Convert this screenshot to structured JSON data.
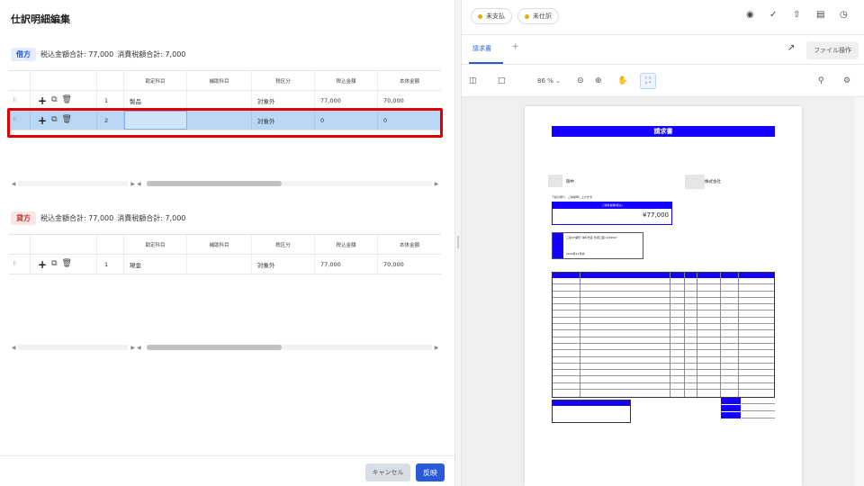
{
  "left": {
    "title": "仕訳明細編集",
    "debit": {
      "badge": "借方",
      "tax_incl_total": "税込金額合計: 77,000",
      "tax_total": "消費税額合計: 7,000"
    },
    "credit": {
      "badge": "貸方",
      "tax_incl_total": "税込金額合計: 77,000",
      "tax_total": "消費税額合計: 7,000"
    },
    "columns": {
      "account": "勘定科目",
      "subaccount": "補助科目",
      "tax_type": "税区分",
      "amount": "税込金額",
      "net": "本体金額"
    },
    "debit_rows": [
      {
        "no": "1",
        "account": "製品",
        "subaccount": "",
        "tax_type": "対象外",
        "amount": "77,000",
        "net": "70,000"
      },
      {
        "no": "2",
        "account": "",
        "subaccount": "",
        "tax_type": "対象外",
        "amount": "0",
        "net": "0"
      }
    ],
    "credit_rows": [
      {
        "no": "1",
        "account": "現金",
        "subaccount": "",
        "tax_type": "対象外",
        "amount": "77,000",
        "net": "70,000"
      }
    ],
    "actions": {
      "add": "+",
      "copy": "⧉",
      "delete": "🗑",
      "handle": "⠿"
    },
    "scroll": {
      "left": "◀",
      "right": "▶",
      "mid": "▶ ◀"
    },
    "footer": {
      "cancel": "キャンセル",
      "apply": "反映"
    }
  },
  "right": {
    "status_chips": [
      "未支払",
      "未仕訳"
    ],
    "status_color": "#f0a800",
    "top_icons": [
      "user-circle-icon",
      "check-icon",
      "share-icon",
      "comment-icon",
      "clock-icon"
    ],
    "tab": "請求書",
    "tab_add": "+",
    "file_ops": "ファイル操作",
    "zoom": "86 %",
    "invoice": {
      "banner": "請求書",
      "to_suffix": "御中",
      "from_name": "株式会社",
      "greeting": "下記の通り、ご請求申し上げます。",
      "amount_label": "ご請求金額(税込)",
      "amount": "¥77,000",
      "bank_line": "三菱UFJ銀行 本町支店 普通口座 1234567",
      "due_line": "2024年12月末"
    },
    "accent": "#1400ff"
  }
}
